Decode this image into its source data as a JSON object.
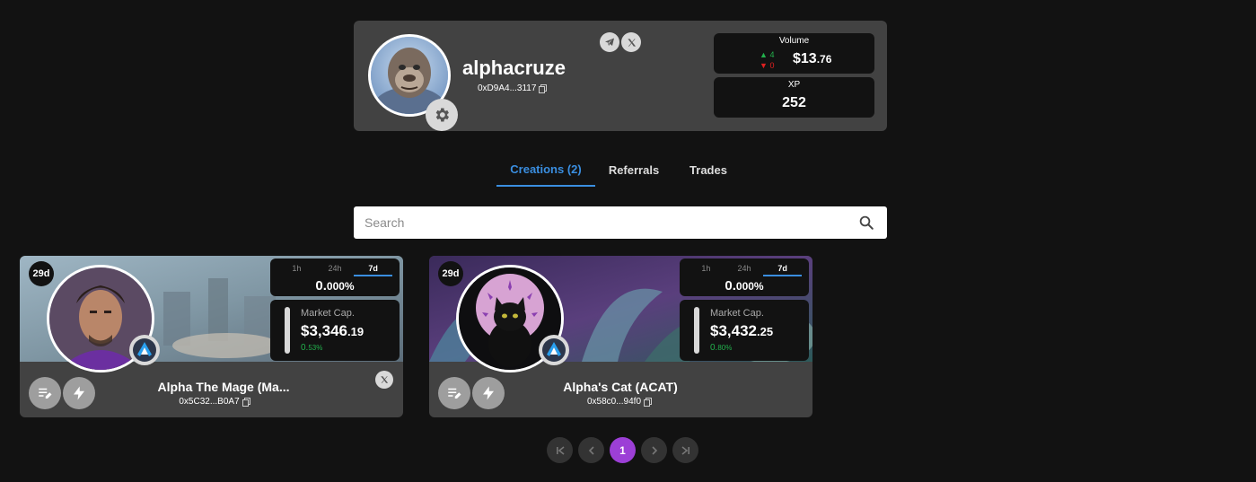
{
  "profile": {
    "username": "alphacruze",
    "address": "0xD9A4...3117",
    "volume": {
      "label": "Volume",
      "up_count": "4",
      "down_count": "0",
      "value_main": "$13",
      "value_cents": ".76"
    },
    "xp": {
      "label": "XP",
      "value": "252"
    }
  },
  "tabs": [
    {
      "label": "Creations (2)",
      "active": true
    },
    {
      "label": "Referrals",
      "active": false
    },
    {
      "label": "Trades",
      "active": false
    }
  ],
  "search": {
    "placeholder": "Search",
    "value": ""
  },
  "cards": [
    {
      "age": "29d",
      "timeframes": [
        "1h",
        "24h",
        "7d"
      ],
      "selected_timeframe": "7d",
      "change_main": "0.",
      "change_small": "000%",
      "market_cap_label": "Market Cap.",
      "market_cap_main": "$3,346",
      "market_cap_cents": ".19",
      "market_cap_change_main": "0.",
      "market_cap_change_small": "53%",
      "name": "Alpha The Mage (Ma...",
      "address": "0x5C32...B0A7"
    },
    {
      "age": "29d",
      "timeframes": [
        "1h",
        "24h",
        "7d"
      ],
      "selected_timeframe": "7d",
      "change_main": "0.",
      "change_small": "000%",
      "market_cap_label": "Market Cap.",
      "market_cap_main": "$3,432",
      "market_cap_cents": ".25",
      "market_cap_change_main": "0.",
      "market_cap_change_small": "80%",
      "name": "Alpha's Cat (ACAT)",
      "address": "0x58c0...94f0"
    }
  ],
  "pagination": {
    "current_page": "1"
  },
  "colors": {
    "accent_blue": "#3a8ee0",
    "active_page": "#9c3fd6",
    "positive": "#22b14c",
    "negative": "#e02020"
  }
}
